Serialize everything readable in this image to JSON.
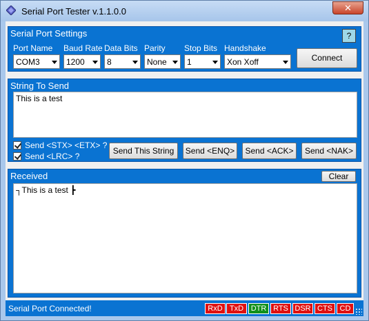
{
  "window": {
    "title": "Serial Port Tester v.1.1.0.0",
    "close_label": "✕"
  },
  "settings": {
    "title": "Serial Port Settings",
    "help_label": "?",
    "port": {
      "label": "Port Name",
      "value": "COM3"
    },
    "baud": {
      "label": "Baud Rate",
      "value": "1200"
    },
    "databits": {
      "label": "Data Bits",
      "value": "8"
    },
    "parity": {
      "label": "Parity",
      "value": "None"
    },
    "stopbits": {
      "label": "Stop Bits",
      "value": "1"
    },
    "handshake": {
      "label": "Handshake",
      "value": "Xon Xoff"
    },
    "connect_label": "Connect"
  },
  "send": {
    "title": "String To Send",
    "text": "This is a test",
    "stx_etx_label": "Send <STX> <ETX> ?",
    "lrc_label": "Send <LRC> ?",
    "send_string_label": "Send This String",
    "enq_label": "Send <ENQ>",
    "ack_label": "Send <ACK>",
    "nak_label": "Send <NAK>"
  },
  "received": {
    "title": "Received",
    "clear_label": "Clear",
    "text": "┐This is a test ┣"
  },
  "status": {
    "text": "Serial Port Connected!",
    "signals": [
      {
        "label": "RxD",
        "color": "#e01010"
      },
      {
        "label": "TxD",
        "color": "#e01010"
      },
      {
        "label": "DTR",
        "color": "#10901a"
      },
      {
        "label": "RTS",
        "color": "#e01010"
      },
      {
        "label": "DSR",
        "color": "#e01010"
      },
      {
        "label": "CTS",
        "color": "#e01010"
      },
      {
        "label": "CD",
        "color": "#e01010"
      }
    ]
  }
}
